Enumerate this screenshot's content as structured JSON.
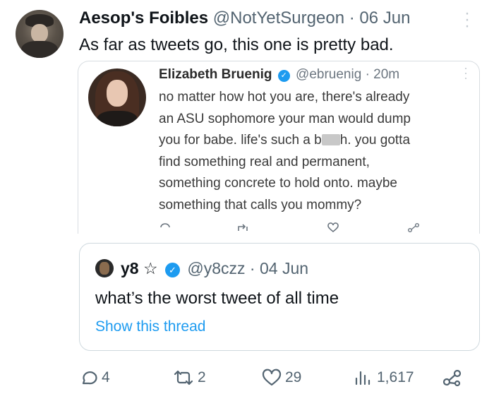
{
  "tweet": {
    "author_name": "Aesop's Foibles",
    "handle": "@NotYetSurgeon",
    "separator": "·",
    "date": "06 Jun",
    "text": "As far as tweets go, this one is pretty bad."
  },
  "quoted_image": {
    "author_name": "Elizabeth Bruenig",
    "handle": "@ebruenig",
    "separator": "·",
    "time": "20m",
    "lines": [
      "no matter how hot you are, there's already",
      "an ASU sophomore your man would dump",
      "you for babe. life's such a b",
      "h. you gotta",
      "find something real and permanent,",
      "something concrete to hold onto. maybe",
      "something that calls you mommy?"
    ]
  },
  "quoted_tweet": {
    "author_name": "y8 ☆",
    "handle": "@y8czz",
    "separator": "·",
    "date": "04 Jun",
    "text": "what’s the worst tweet of all time",
    "show_thread": "Show this thread"
  },
  "actions": {
    "replies": "4",
    "retweets": "2",
    "likes": "29",
    "views": "1,617"
  },
  "colors": {
    "accent": "#1d9bf0",
    "secondary_text": "#536471",
    "border": "#cfd9de"
  },
  "icons": [
    "more-icon",
    "verified-icon",
    "reply-icon",
    "retweet-icon",
    "like-icon",
    "views-icon",
    "share-icon"
  ]
}
